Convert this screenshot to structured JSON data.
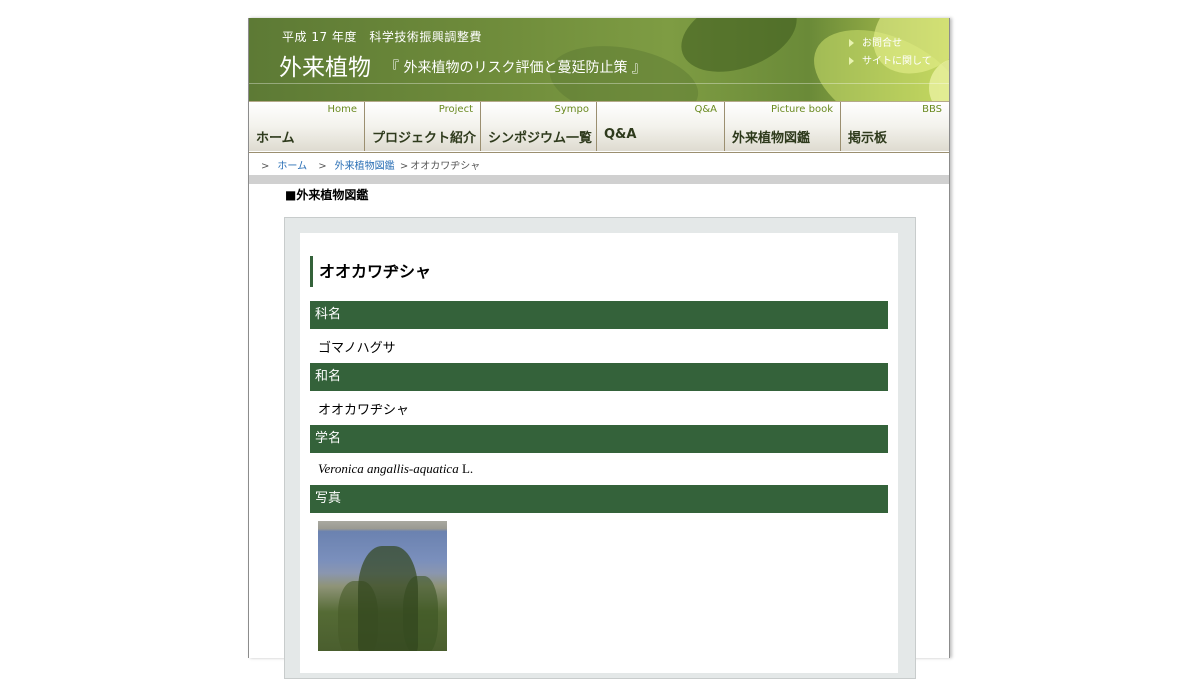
{
  "header": {
    "subtitle": "平成 17 年度　科学技術振興調整費",
    "title": "外来植物",
    "tagline": "『 外来植物のリスク評価と蔓延防止策 』",
    "links": [
      "お問合せ",
      "サイトに関して"
    ]
  },
  "nav": [
    {
      "en": "Home",
      "ja": "ホーム"
    },
    {
      "en": "Project",
      "ja": "プロジェクト紹介"
    },
    {
      "en": "Sympo",
      "ja": "シンポジウム一覧"
    },
    {
      "en": "Q&A",
      "ja": "Q&A"
    },
    {
      "en": "Picture book",
      "ja": "外来植物図鑑"
    },
    {
      "en": "BBS",
      "ja": "掲示板"
    }
  ],
  "breadcrumb": {
    "items": [
      "ホーム",
      "外来植物図鑑"
    ],
    "current": "オオカワヂシャ",
    "separator": ">"
  },
  "section_heading": "■外来植物図鑑",
  "plant": {
    "title": "オオカワヂシャ",
    "fields": [
      {
        "label": "科名",
        "value": "ゴマノハグサ"
      },
      {
        "label": "和名",
        "value": "オオカワヂシャ"
      },
      {
        "label": "学名",
        "value_italic": "Veronica angallis-aquatica",
        "value_suffix": " L."
      },
      {
        "label": "写真"
      }
    ]
  },
  "colors": {
    "field_header_bg": "#34623a",
    "link": "#2a6fb5",
    "nav_en": "#6a8a20"
  }
}
